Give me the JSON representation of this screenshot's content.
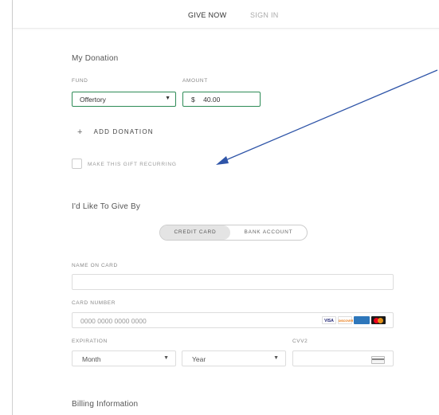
{
  "nav": {
    "give_now": "GIVE NOW",
    "sign_in": "SIGN IN"
  },
  "donation": {
    "title": "My Donation",
    "fund_label": "FUND",
    "fund_value": "Offertory",
    "amount_label": "AMOUNT",
    "currency": "$",
    "amount_value": "40.00",
    "add_donation": "ADD DONATION",
    "recurring_label": "MAKE THIS GIFT RECURRING",
    "recurring_checked": false
  },
  "give_by": {
    "title": "I'd Like To Give By",
    "options": [
      "CREDIT CARD",
      "BANK ACCOUNT"
    ],
    "selected": "CREDIT CARD"
  },
  "card": {
    "name_label": "NAME ON CARD",
    "name_value": "",
    "number_label": "CARD NUMBER",
    "number_placeholder": "0000 0000 0000 0000",
    "expiration_label": "EXPIRATION",
    "month_value": "Month",
    "year_value": "Year",
    "cvv_label": "CVV2",
    "brands": [
      "VISA",
      "DISCOVER",
      "AMEX",
      "MASTERCARD"
    ]
  },
  "billing": {
    "title": "Billing Information"
  },
  "colors": {
    "accent_green": "#2e8b57",
    "annotation_arrow": "#2f55a8"
  },
  "icons": {
    "caret": "chevron-down-icon",
    "plus": "plus-icon",
    "cvv": "cvv-card-icon"
  }
}
